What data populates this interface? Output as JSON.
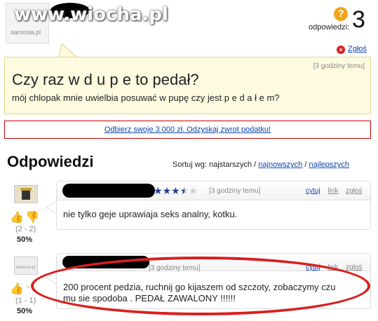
{
  "watermark": "www.wiocha.pl",
  "header": {
    "avatar_label": "samosia.pl",
    "answers_label": "odpowiedzi:",
    "answers_count": "3",
    "report_label": "Zgłoś"
  },
  "question": {
    "time": "[3 godziny temu]",
    "title": "Czy raz w d u p e to pedał?",
    "body": "mój chlopak mnie uwielbia posuwać w pupę czy jest p e d a ł e m?"
  },
  "ad": {
    "link": "Odbierz swoje 3 000 zł. Odzyskaj zwrot podatku!"
  },
  "answers_section": {
    "title": "Odpowiedzi",
    "sort_prefix": "Sortuj wg: najstarszych /",
    "sort_newest": "najnowszych",
    "sort_sep": "/",
    "sort_best": "najlepszych"
  },
  "answers": [
    {
      "time": "[3 godziny temu]",
      "rating": 3.5,
      "quote_label": "cytuj",
      "link_label": "link",
      "report_label": "zgłoś",
      "text": "nie tylko geje uprawiaja seks analny, kotku.",
      "votes": "(2 - 2)",
      "percent": "50%"
    },
    {
      "avatar_label": "samosia.pl",
      "time": "[3 godziny temu]",
      "quote_label": "cytuj",
      "link_label": "link",
      "report_label": "zgłoś",
      "text_line1": "200 procent pedzia, ruchnij go kijaszem od szczoty, zobaczymy czu",
      "text_line2": "mu sie spodoba . PEDAŁ ZAWALONY !!!!!!",
      "votes": "(1 - 1)",
      "percent": "50%"
    }
  ],
  "colors": {
    "link": "#1144aa",
    "question_bg": "#fffbe0",
    "ad_border": "#cc0000",
    "highlight_oval": "#d91f1f",
    "star_on": "#1c3f94"
  }
}
